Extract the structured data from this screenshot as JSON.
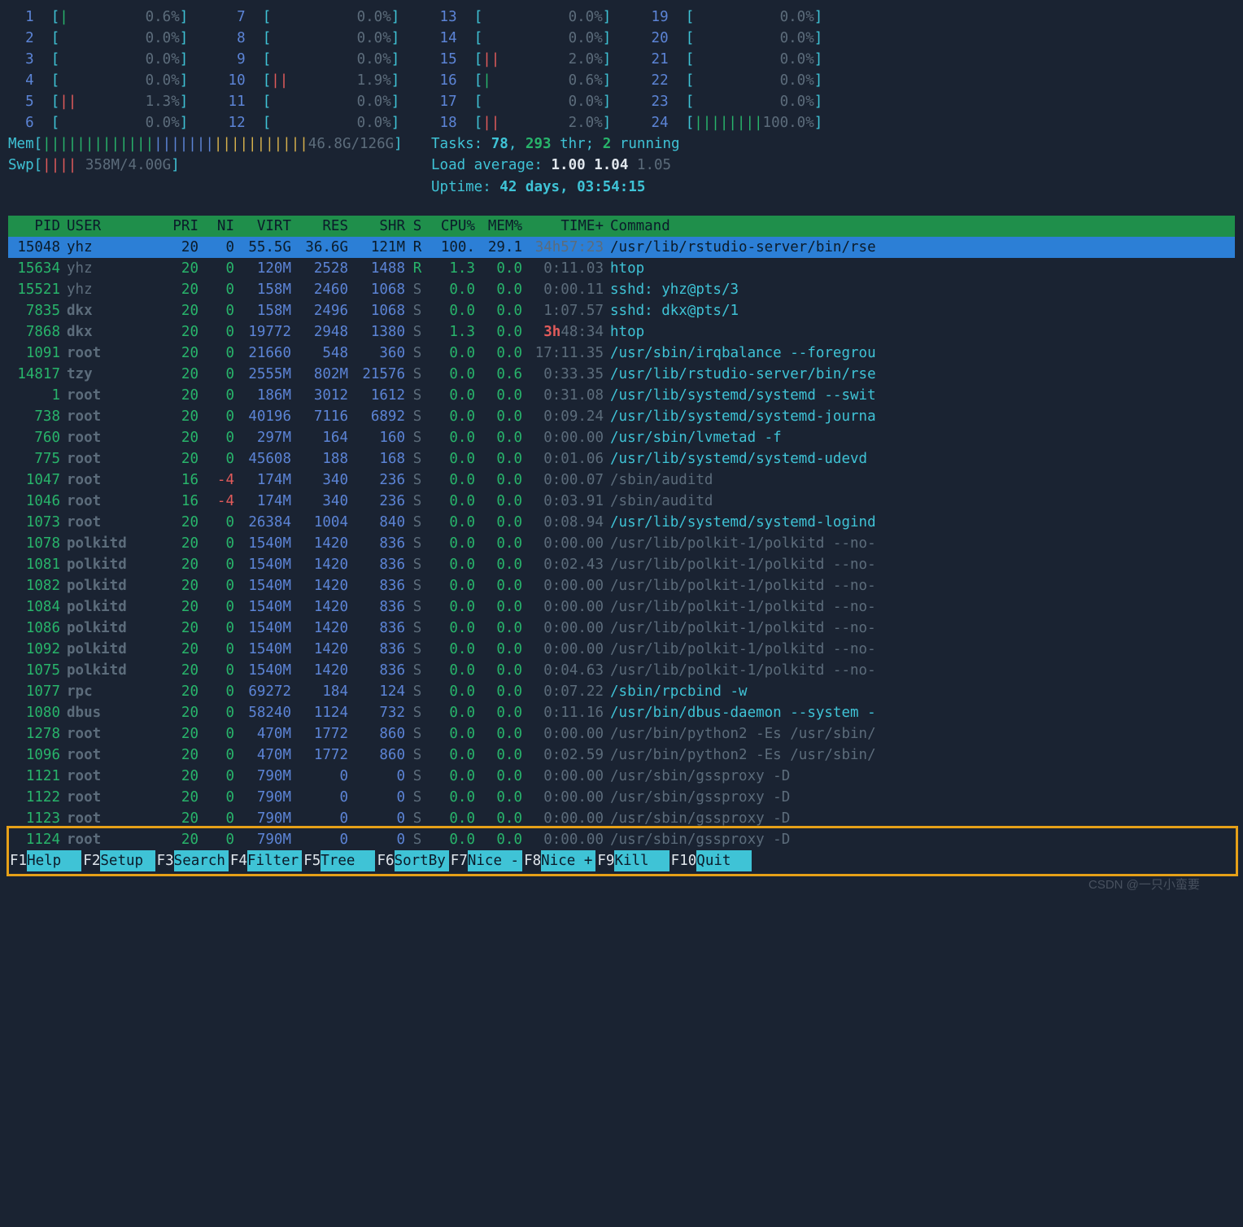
{
  "cpu_meters": [
    {
      "n": 1,
      "bar": "|",
      "pct": "0.6%",
      "bar_color": "green"
    },
    {
      "n": 2,
      "bar": "",
      "pct": "0.0%",
      "bar_color": "green"
    },
    {
      "n": 3,
      "bar": "",
      "pct": "0.0%",
      "bar_color": "green"
    },
    {
      "n": 4,
      "bar": "",
      "pct": "0.0%",
      "bar_color": "green"
    },
    {
      "n": 5,
      "bar": "||",
      "pct": "1.3%",
      "bar_color": "red"
    },
    {
      "n": 6,
      "bar": "",
      "pct": "0.0%",
      "bar_color": "green"
    },
    {
      "n": 7,
      "bar": "",
      "pct": "0.0%",
      "bar_color": "green"
    },
    {
      "n": 8,
      "bar": "",
      "pct": "0.0%",
      "bar_color": "green"
    },
    {
      "n": 9,
      "bar": "",
      "pct": "0.0%",
      "bar_color": "green"
    },
    {
      "n": 10,
      "bar": "||",
      "pct": "1.9%",
      "bar_color": "red"
    },
    {
      "n": 11,
      "bar": "",
      "pct": "0.0%",
      "bar_color": "green"
    },
    {
      "n": 12,
      "bar": "",
      "pct": "0.0%",
      "bar_color": "green"
    },
    {
      "n": 13,
      "bar": "",
      "pct": "0.0%",
      "bar_color": "green"
    },
    {
      "n": 14,
      "bar": "",
      "pct": "0.0%",
      "bar_color": "green"
    },
    {
      "n": 15,
      "bar": "||",
      "pct": "2.0%",
      "bar_color": "red"
    },
    {
      "n": 16,
      "bar": "|",
      "pct": "0.6%",
      "bar_color": "green"
    },
    {
      "n": 17,
      "bar": "",
      "pct": "0.0%",
      "bar_color": "green"
    },
    {
      "n": 18,
      "bar": "||",
      "pct": "2.0%",
      "bar_color": "red"
    },
    {
      "n": 19,
      "bar": "",
      "pct": "0.0%",
      "bar_color": "green"
    },
    {
      "n": 20,
      "bar": "",
      "pct": "0.0%",
      "bar_color": "green"
    },
    {
      "n": 21,
      "bar": "",
      "pct": "0.0%",
      "bar_color": "green"
    },
    {
      "n": 22,
      "bar": "",
      "pct": "0.0%",
      "bar_color": "green"
    },
    {
      "n": 23,
      "bar": "",
      "pct": "0.0%",
      "bar_color": "green"
    },
    {
      "n": 24,
      "bar": "||||||||",
      "pct": "100.0%",
      "bar_color": "green"
    }
  ],
  "mem": {
    "label": "Mem",
    "bar": "|||||||||||||||||||||||||||||||",
    "value": "46.8G/126G"
  },
  "swp": {
    "label": "Swp",
    "bar": "||||",
    "value": "358M/4.00G"
  },
  "tasks": {
    "label": "Tasks: ",
    "total": "78",
    "sep": ", ",
    "thr": "293",
    "thr_label": " thr; ",
    "running": "2",
    "running_label": " running"
  },
  "loadavg": {
    "label": "Load average: ",
    "v1": "1.00",
    "v2": "1.04",
    "v3": "1.05"
  },
  "uptime": {
    "label": "Uptime: ",
    "value": "42 days, 03:54:15"
  },
  "columns": {
    "pid": "PID",
    "user": "USER",
    "pri": "PRI",
    "ni": "NI",
    "virt": "VIRT",
    "res": "RES",
    "shr": "SHR",
    "s": "S",
    "cpu": "CPU%",
    "mem": "MEM%",
    "time": "TIME+",
    "cmd": "Command"
  },
  "processes": [
    {
      "pid": "15048",
      "user": "yhz",
      "pri": "20",
      "ni": "0",
      "virt": "55.5G",
      "res": "36.6G",
      "shr": "121M",
      "s": "R",
      "cpu": "100.",
      "mem": "29.1",
      "time": "34h57:23",
      "time_hot": "",
      "cmd": "/usr/lib/rstudio-server/bin/rse",
      "sel": true,
      "bold": false,
      "cmd_dim": false
    },
    {
      "pid": "15634",
      "user": "yhz",
      "pri": "20",
      "ni": "0",
      "virt": "120M",
      "res": "2528",
      "shr": "1488",
      "s": "R",
      "cpu": "1.3",
      "mem": "0.0",
      "time": "0:11.03",
      "time_hot": "",
      "cmd": "htop",
      "sel": false,
      "bold": false,
      "cmd_dim": false,
      "s_green": true
    },
    {
      "pid": "15521",
      "user": "yhz",
      "pri": "20",
      "ni": "0",
      "virt": "158M",
      "res": "2460",
      "shr": "1068",
      "s": "S",
      "cpu": "0.0",
      "mem": "0.0",
      "time": "0:00.11",
      "time_hot": "",
      "cmd": "sshd: yhz@pts/3",
      "sel": false,
      "bold": false,
      "cmd_dim": false
    },
    {
      "pid": "7835",
      "user": "dkx",
      "pri": "20",
      "ni": "0",
      "virt": "158M",
      "res": "2496",
      "shr": "1068",
      "s": "S",
      "cpu": "0.0",
      "mem": "0.0",
      "time": "1:07.57",
      "time_hot": "",
      "cmd": "sshd: dkx@pts/1",
      "sel": false,
      "bold": true,
      "cmd_dim": false
    },
    {
      "pid": "7868",
      "user": "dkx",
      "pri": "20",
      "ni": "0",
      "virt": "19772",
      "res": "2948",
      "shr": "1380",
      "s": "S",
      "cpu": "1.3",
      "mem": "0.0",
      "time": "48:34",
      "time_hot": "3h",
      "cmd": "htop",
      "sel": false,
      "bold": true,
      "cmd_dim": false
    },
    {
      "pid": "1091",
      "user": "root",
      "pri": "20",
      "ni": "0",
      "virt": "21660",
      "res": "548",
      "shr": "360",
      "s": "S",
      "cpu": "0.0",
      "mem": "0.0",
      "time": "17:11.35",
      "time_hot": "",
      "cmd": "/usr/sbin/irqbalance --foregrou",
      "sel": false,
      "bold": true,
      "cmd_dim": false
    },
    {
      "pid": "14817",
      "user": "tzy",
      "pri": "20",
      "ni": "0",
      "virt": "2555M",
      "res": "802M",
      "shr": "21576",
      "s": "S",
      "cpu": "0.0",
      "mem": "0.6",
      "time": "0:33.35",
      "time_hot": "",
      "cmd": "/usr/lib/rstudio-server/bin/rse",
      "sel": false,
      "bold": true,
      "cmd_dim": false
    },
    {
      "pid": "1",
      "user": "root",
      "pri": "20",
      "ni": "0",
      "virt": "186M",
      "res": "3012",
      "shr": "1612",
      "s": "S",
      "cpu": "0.0",
      "mem": "0.0",
      "time": "0:31.08",
      "time_hot": "",
      "cmd": "/usr/lib/systemd/systemd --swit",
      "sel": false,
      "bold": true,
      "cmd_dim": false
    },
    {
      "pid": "738",
      "user": "root",
      "pri": "20",
      "ni": "0",
      "virt": "40196",
      "res": "7116",
      "shr": "6892",
      "s": "S",
      "cpu": "0.0",
      "mem": "0.0",
      "time": "0:09.24",
      "time_hot": "",
      "cmd": "/usr/lib/systemd/systemd-journa",
      "sel": false,
      "bold": true,
      "cmd_dim": false
    },
    {
      "pid": "760",
      "user": "root",
      "pri": "20",
      "ni": "0",
      "virt": "297M",
      "res": "164",
      "shr": "160",
      "s": "S",
      "cpu": "0.0",
      "mem": "0.0",
      "time": "0:00.00",
      "time_hot": "",
      "cmd": "/usr/sbin/lvmetad -f",
      "sel": false,
      "bold": true,
      "cmd_dim": false
    },
    {
      "pid": "775",
      "user": "root",
      "pri": "20",
      "ni": "0",
      "virt": "45608",
      "res": "188",
      "shr": "168",
      "s": "S",
      "cpu": "0.0",
      "mem": "0.0",
      "time": "0:01.06",
      "time_hot": "",
      "cmd": "/usr/lib/systemd/systemd-udevd",
      "sel": false,
      "bold": true,
      "cmd_dim": false
    },
    {
      "pid": "1047",
      "user": "root",
      "pri": "16",
      "ni": "-4",
      "virt": "174M",
      "res": "340",
      "shr": "236",
      "s": "S",
      "cpu": "0.0",
      "mem": "0.0",
      "time": "0:00.07",
      "time_hot": "",
      "cmd": "/sbin/auditd",
      "sel": false,
      "bold": true,
      "cmd_dim": true,
      "ni_red": true
    },
    {
      "pid": "1046",
      "user": "root",
      "pri": "16",
      "ni": "-4",
      "virt": "174M",
      "res": "340",
      "shr": "236",
      "s": "S",
      "cpu": "0.0",
      "mem": "0.0",
      "time": "0:03.91",
      "time_hot": "",
      "cmd": "/sbin/auditd",
      "sel": false,
      "bold": true,
      "cmd_dim": true,
      "ni_red": true
    },
    {
      "pid": "1073",
      "user": "root",
      "pri": "20",
      "ni": "0",
      "virt": "26384",
      "res": "1004",
      "shr": "840",
      "s": "S",
      "cpu": "0.0",
      "mem": "0.0",
      "time": "0:08.94",
      "time_hot": "",
      "cmd": "/usr/lib/systemd/systemd-logind",
      "sel": false,
      "bold": true,
      "cmd_dim": false
    },
    {
      "pid": "1078",
      "user": "polkitd",
      "pri": "20",
      "ni": "0",
      "virt": "1540M",
      "res": "1420",
      "shr": "836",
      "s": "S",
      "cpu": "0.0",
      "mem": "0.0",
      "time": "0:00.00",
      "time_hot": "",
      "cmd": "/usr/lib/polkit-1/polkitd --no-",
      "sel": false,
      "bold": true,
      "cmd_dim": true
    },
    {
      "pid": "1081",
      "user": "polkitd",
      "pri": "20",
      "ni": "0",
      "virt": "1540M",
      "res": "1420",
      "shr": "836",
      "s": "S",
      "cpu": "0.0",
      "mem": "0.0",
      "time": "0:02.43",
      "time_hot": "",
      "cmd": "/usr/lib/polkit-1/polkitd --no-",
      "sel": false,
      "bold": true,
      "cmd_dim": true
    },
    {
      "pid": "1082",
      "user": "polkitd",
      "pri": "20",
      "ni": "0",
      "virt": "1540M",
      "res": "1420",
      "shr": "836",
      "s": "S",
      "cpu": "0.0",
      "mem": "0.0",
      "time": "0:00.00",
      "time_hot": "",
      "cmd": "/usr/lib/polkit-1/polkitd --no-",
      "sel": false,
      "bold": true,
      "cmd_dim": true
    },
    {
      "pid": "1084",
      "user": "polkitd",
      "pri": "20",
      "ni": "0",
      "virt": "1540M",
      "res": "1420",
      "shr": "836",
      "s": "S",
      "cpu": "0.0",
      "mem": "0.0",
      "time": "0:00.00",
      "time_hot": "",
      "cmd": "/usr/lib/polkit-1/polkitd --no-",
      "sel": false,
      "bold": true,
      "cmd_dim": true
    },
    {
      "pid": "1086",
      "user": "polkitd",
      "pri": "20",
      "ni": "0",
      "virt": "1540M",
      "res": "1420",
      "shr": "836",
      "s": "S",
      "cpu": "0.0",
      "mem": "0.0",
      "time": "0:00.00",
      "time_hot": "",
      "cmd": "/usr/lib/polkit-1/polkitd --no-",
      "sel": false,
      "bold": true,
      "cmd_dim": true
    },
    {
      "pid": "1092",
      "user": "polkitd",
      "pri": "20",
      "ni": "0",
      "virt": "1540M",
      "res": "1420",
      "shr": "836",
      "s": "S",
      "cpu": "0.0",
      "mem": "0.0",
      "time": "0:00.00",
      "time_hot": "",
      "cmd": "/usr/lib/polkit-1/polkitd --no-",
      "sel": false,
      "bold": true,
      "cmd_dim": true
    },
    {
      "pid": "1075",
      "user": "polkitd",
      "pri": "20",
      "ni": "0",
      "virt": "1540M",
      "res": "1420",
      "shr": "836",
      "s": "S",
      "cpu": "0.0",
      "mem": "0.0",
      "time": "0:04.63",
      "time_hot": "",
      "cmd": "/usr/lib/polkit-1/polkitd --no-",
      "sel": false,
      "bold": true,
      "cmd_dim": true
    },
    {
      "pid": "1077",
      "user": "rpc",
      "pri": "20",
      "ni": "0",
      "virt": "69272",
      "res": "184",
      "shr": "124",
      "s": "S",
      "cpu": "0.0",
      "mem": "0.0",
      "time": "0:07.22",
      "time_hot": "",
      "cmd": "/sbin/rpcbind -w",
      "sel": false,
      "bold": true,
      "cmd_dim": false
    },
    {
      "pid": "1080",
      "user": "dbus",
      "pri": "20",
      "ni": "0",
      "virt": "58240",
      "res": "1124",
      "shr": "732",
      "s": "S",
      "cpu": "0.0",
      "mem": "0.0",
      "time": "0:11.16",
      "time_hot": "",
      "cmd": "/usr/bin/dbus-daemon --system -",
      "sel": false,
      "bold": true,
      "cmd_dim": false
    },
    {
      "pid": "1278",
      "user": "root",
      "pri": "20",
      "ni": "0",
      "virt": "470M",
      "res": "1772",
      "shr": "860",
      "s": "S",
      "cpu": "0.0",
      "mem": "0.0",
      "time": "0:00.00",
      "time_hot": "",
      "cmd": "/usr/bin/python2 -Es /usr/sbin/",
      "sel": false,
      "bold": true,
      "cmd_dim": true
    },
    {
      "pid": "1096",
      "user": "root",
      "pri": "20",
      "ni": "0",
      "virt": "470M",
      "res": "1772",
      "shr": "860",
      "s": "S",
      "cpu": "0.0",
      "mem": "0.0",
      "time": "0:02.59",
      "time_hot": "",
      "cmd": "/usr/bin/python2 -Es /usr/sbin/",
      "sel": false,
      "bold": true,
      "cmd_dim": true
    },
    {
      "pid": "1121",
      "user": "root",
      "pri": "20",
      "ni": "0",
      "virt": "790M",
      "res": "0",
      "shr": "0",
      "s": "S",
      "cpu": "0.0",
      "mem": "0.0",
      "time": "0:00.00",
      "time_hot": "",
      "cmd": "/usr/sbin/gssproxy -D",
      "sel": false,
      "bold": true,
      "cmd_dim": true
    },
    {
      "pid": "1122",
      "user": "root",
      "pri": "20",
      "ni": "0",
      "virt": "790M",
      "res": "0",
      "shr": "0",
      "s": "S",
      "cpu": "0.0",
      "mem": "0.0",
      "time": "0:00.00",
      "time_hot": "",
      "cmd": "/usr/sbin/gssproxy -D",
      "sel": false,
      "bold": true,
      "cmd_dim": true
    },
    {
      "pid": "1123",
      "user": "root",
      "pri": "20",
      "ni": "0",
      "virt": "790M",
      "res": "0",
      "shr": "0",
      "s": "S",
      "cpu": "0.0",
      "mem": "0.0",
      "time": "0:00.00",
      "time_hot": "",
      "cmd": "/usr/sbin/gssproxy -D",
      "sel": false,
      "bold": true,
      "cmd_dim": true
    },
    {
      "pid": "1124",
      "user": "root",
      "pri": "20",
      "ni": "0",
      "virt": "790M",
      "res": "0",
      "shr": "0",
      "s": "S",
      "cpu": "0.0",
      "mem": "0.0",
      "time": "0:00.00",
      "time_hot": "",
      "cmd": "/usr/sbin/gssproxy -D",
      "sel": false,
      "bold": true,
      "cmd_dim": true
    }
  ],
  "footer": [
    {
      "key": "F1",
      "label": "Help  "
    },
    {
      "key": "F2",
      "label": "Setup "
    },
    {
      "key": "F3",
      "label": "Search"
    },
    {
      "key": "F4",
      "label": "Filter"
    },
    {
      "key": "F5",
      "label": "Tree  "
    },
    {
      "key": "F6",
      "label": "SortBy"
    },
    {
      "key": "F7",
      "label": "Nice -"
    },
    {
      "key": "F8",
      "label": "Nice +"
    },
    {
      "key": "F9",
      "label": "Kill  "
    },
    {
      "key": "F10",
      "label": "Quit  "
    }
  ],
  "watermark": "CSDN @一只小蛮要"
}
